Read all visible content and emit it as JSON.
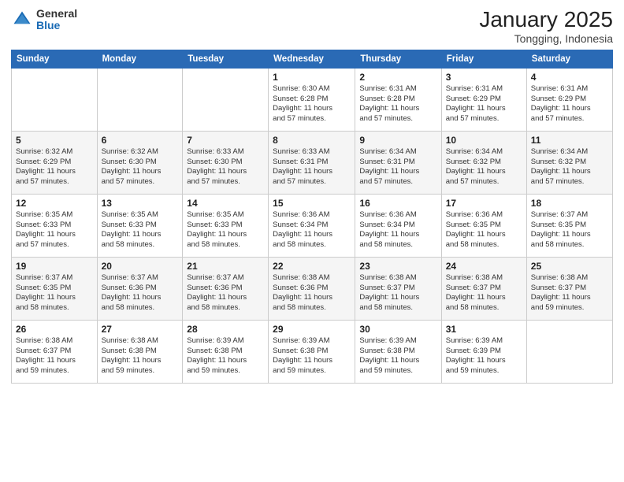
{
  "logo": {
    "general": "General",
    "blue": "Blue"
  },
  "header": {
    "month_year": "January 2025",
    "location": "Tongging, Indonesia"
  },
  "days_of_week": [
    "Sunday",
    "Monday",
    "Tuesday",
    "Wednesday",
    "Thursday",
    "Friday",
    "Saturday"
  ],
  "weeks": [
    [
      null,
      null,
      null,
      {
        "num": "1",
        "sunrise": "6:30 AM",
        "sunset": "6:28 PM",
        "daylight": "11 hours and 57 minutes."
      },
      {
        "num": "2",
        "sunrise": "6:31 AM",
        "sunset": "6:28 PM",
        "daylight": "11 hours and 57 minutes."
      },
      {
        "num": "3",
        "sunrise": "6:31 AM",
        "sunset": "6:29 PM",
        "daylight": "11 hours and 57 minutes."
      },
      {
        "num": "4",
        "sunrise": "6:31 AM",
        "sunset": "6:29 PM",
        "daylight": "11 hours and 57 minutes."
      }
    ],
    [
      {
        "num": "5",
        "sunrise": "6:32 AM",
        "sunset": "6:29 PM",
        "daylight": "11 hours and 57 minutes."
      },
      {
        "num": "6",
        "sunrise": "6:32 AM",
        "sunset": "6:30 PM",
        "daylight": "11 hours and 57 minutes."
      },
      {
        "num": "7",
        "sunrise": "6:33 AM",
        "sunset": "6:30 PM",
        "daylight": "11 hours and 57 minutes."
      },
      {
        "num": "8",
        "sunrise": "6:33 AM",
        "sunset": "6:31 PM",
        "daylight": "11 hours and 57 minutes."
      },
      {
        "num": "9",
        "sunrise": "6:34 AM",
        "sunset": "6:31 PM",
        "daylight": "11 hours and 57 minutes."
      },
      {
        "num": "10",
        "sunrise": "6:34 AM",
        "sunset": "6:32 PM",
        "daylight": "11 hours and 57 minutes."
      },
      {
        "num": "11",
        "sunrise": "6:34 AM",
        "sunset": "6:32 PM",
        "daylight": "11 hours and 57 minutes."
      }
    ],
    [
      {
        "num": "12",
        "sunrise": "6:35 AM",
        "sunset": "6:33 PM",
        "daylight": "11 hours and 57 minutes."
      },
      {
        "num": "13",
        "sunrise": "6:35 AM",
        "sunset": "6:33 PM",
        "daylight": "11 hours and 58 minutes."
      },
      {
        "num": "14",
        "sunrise": "6:35 AM",
        "sunset": "6:33 PM",
        "daylight": "11 hours and 58 minutes."
      },
      {
        "num": "15",
        "sunrise": "6:36 AM",
        "sunset": "6:34 PM",
        "daylight": "11 hours and 58 minutes."
      },
      {
        "num": "16",
        "sunrise": "6:36 AM",
        "sunset": "6:34 PM",
        "daylight": "11 hours and 58 minutes."
      },
      {
        "num": "17",
        "sunrise": "6:36 AM",
        "sunset": "6:35 PM",
        "daylight": "11 hours and 58 minutes."
      },
      {
        "num": "18",
        "sunrise": "6:37 AM",
        "sunset": "6:35 PM",
        "daylight": "11 hours and 58 minutes."
      }
    ],
    [
      {
        "num": "19",
        "sunrise": "6:37 AM",
        "sunset": "6:35 PM",
        "daylight": "11 hours and 58 minutes."
      },
      {
        "num": "20",
        "sunrise": "6:37 AM",
        "sunset": "6:36 PM",
        "daylight": "11 hours and 58 minutes."
      },
      {
        "num": "21",
        "sunrise": "6:37 AM",
        "sunset": "6:36 PM",
        "daylight": "11 hours and 58 minutes."
      },
      {
        "num": "22",
        "sunrise": "6:38 AM",
        "sunset": "6:36 PM",
        "daylight": "11 hours and 58 minutes."
      },
      {
        "num": "23",
        "sunrise": "6:38 AM",
        "sunset": "6:37 PM",
        "daylight": "11 hours and 58 minutes."
      },
      {
        "num": "24",
        "sunrise": "6:38 AM",
        "sunset": "6:37 PM",
        "daylight": "11 hours and 58 minutes."
      },
      {
        "num": "25",
        "sunrise": "6:38 AM",
        "sunset": "6:37 PM",
        "daylight": "11 hours and 59 minutes."
      }
    ],
    [
      {
        "num": "26",
        "sunrise": "6:38 AM",
        "sunset": "6:37 PM",
        "daylight": "11 hours and 59 minutes."
      },
      {
        "num": "27",
        "sunrise": "6:38 AM",
        "sunset": "6:38 PM",
        "daylight": "11 hours and 59 minutes."
      },
      {
        "num": "28",
        "sunrise": "6:39 AM",
        "sunset": "6:38 PM",
        "daylight": "11 hours and 59 minutes."
      },
      {
        "num": "29",
        "sunrise": "6:39 AM",
        "sunset": "6:38 PM",
        "daylight": "11 hours and 59 minutes."
      },
      {
        "num": "30",
        "sunrise": "6:39 AM",
        "sunset": "6:38 PM",
        "daylight": "11 hours and 59 minutes."
      },
      {
        "num": "31",
        "sunrise": "6:39 AM",
        "sunset": "6:39 PM",
        "daylight": "11 hours and 59 minutes."
      },
      null
    ]
  ],
  "labels": {
    "sunrise": "Sunrise:",
    "sunset": "Sunset:",
    "daylight": "Daylight:"
  }
}
